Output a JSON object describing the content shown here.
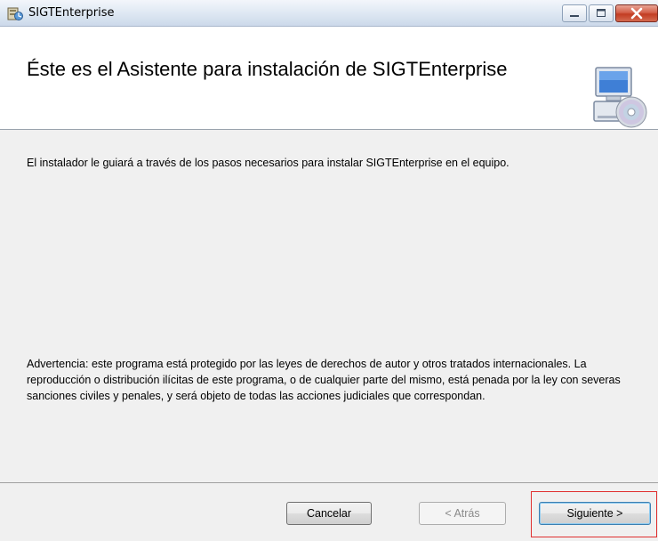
{
  "window": {
    "title": "SIGTEnterprise",
    "controls": [
      "minimize",
      "maximize",
      "close"
    ]
  },
  "header": {
    "title": "Éste es el Asistente para instalación de SIGTEnterprise",
    "graphic_icon": "computer-cd-icon"
  },
  "body": {
    "intro": "El instalador le guiará a través de los pasos necesarios para instalar SIGTEnterprise en el equipo.",
    "warning": "Advertencia: este programa está protegido por las leyes de derechos de autor y otros tratados internacionales. La reproducción o distribución ilícitas de este programa, o de cualquier parte del mismo, está penada por la ley con severas sanciones civiles y penales, y será objeto de todas las acciones judiciales que correspondan."
  },
  "footer": {
    "cancel_label": "Cancelar",
    "back_label": "< Atrás",
    "next_label": "Siguiente >"
  },
  "colors": {
    "highlight": "#e03030",
    "close_button": "#c23c22"
  }
}
